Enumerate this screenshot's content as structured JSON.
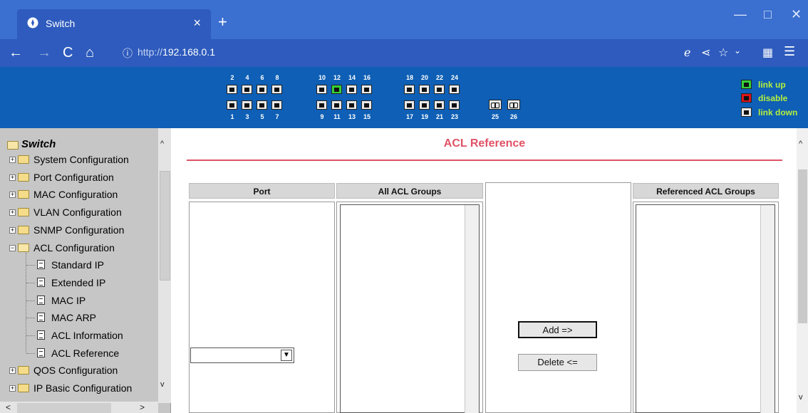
{
  "browser": {
    "tab_title": "Switch",
    "tab_close": "×",
    "new_tab": "+",
    "url_protocol": "http://",
    "url_host": "192.168.0.1",
    "window_controls": {
      "minimize": "—",
      "maximize": "□",
      "close": "✕"
    }
  },
  "switch_panel": {
    "top_port_labels": [
      "2",
      "4",
      "6",
      "8",
      "10",
      "12",
      "14",
      "16",
      "18",
      "20",
      "22",
      "24"
    ],
    "bottom_port_labels": [
      "1",
      "3",
      "5",
      "7",
      "9",
      "11",
      "13",
      "15",
      "17",
      "19",
      "21",
      "23"
    ],
    "fiber_port_labels": [
      "25",
      "26"
    ],
    "link_up_ports": [
      "12"
    ],
    "colors": {
      "link_up": "#36d13a",
      "disable": "#e0141a",
      "link_down": "#e9e9e9",
      "legend_text": "#b6f03c",
      "panel_bg": "#0e5fb5"
    },
    "legend": {
      "link_up": "link up",
      "disable": "disable",
      "link_down": "link down"
    }
  },
  "sidebar": {
    "root": "Switch",
    "items": [
      {
        "label": "System Configuration"
      },
      {
        "label": "Port Configuration"
      },
      {
        "label": "MAC Configuration"
      },
      {
        "label": "VLAN Configuration"
      },
      {
        "label": "SNMP Configuration"
      },
      {
        "label": "ACL Configuration"
      },
      {
        "label": "Standard IP"
      },
      {
        "label": "Extended IP"
      },
      {
        "label": "MAC IP"
      },
      {
        "label": "MAC ARP"
      },
      {
        "label": "ACL Information"
      },
      {
        "label": "ACL Reference"
      },
      {
        "label": "QOS Configuration"
      },
      {
        "label": "IP Basic Configuration"
      }
    ]
  },
  "main": {
    "title": "ACL Reference",
    "title_color": "#e05266",
    "columns": {
      "port": "Port",
      "all_acl_groups": "All ACL Groups",
      "referenced_acl_groups": "Referenced ACL Groups"
    },
    "port_select_value": "",
    "add_button": "Add =>",
    "delete_button": "Delete <="
  }
}
